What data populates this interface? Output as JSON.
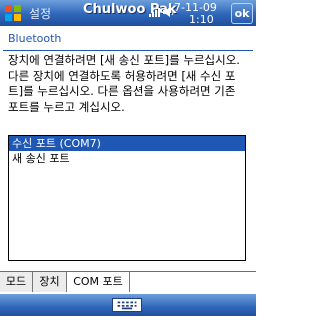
{
  "titlebar": {
    "title": "설정",
    "overlay_text": "Chulwoo Pak",
    "date": "7-11-09",
    "time": "1:10",
    "ok_label": "ok"
  },
  "header": {
    "title": "Bluetooth"
  },
  "instructions": "장치에 연결하려면 [새 송신 포트]를 누르십시오. 다른 장치에 연결하도록 허용하려면 [새 수신 포트]를 누르십시오. 다른 옵션을 사용하려면 기존 포트를 누르고 계십시오.",
  "ports": [
    {
      "label": "수신 포트 (COM7)",
      "selected": true
    },
    {
      "label": "새 송신 포트",
      "selected": false
    }
  ],
  "tabs": [
    {
      "label": "모드"
    },
    {
      "label": "장치"
    },
    {
      "label": "COM 포트",
      "active": true
    }
  ],
  "icons": [
    "windows-start-icon",
    "signal-icon",
    "volume-icon",
    "keyboard-icon"
  ],
  "colors": {
    "accent": "#1f57b5",
    "title_bar": "#2f66b9"
  }
}
